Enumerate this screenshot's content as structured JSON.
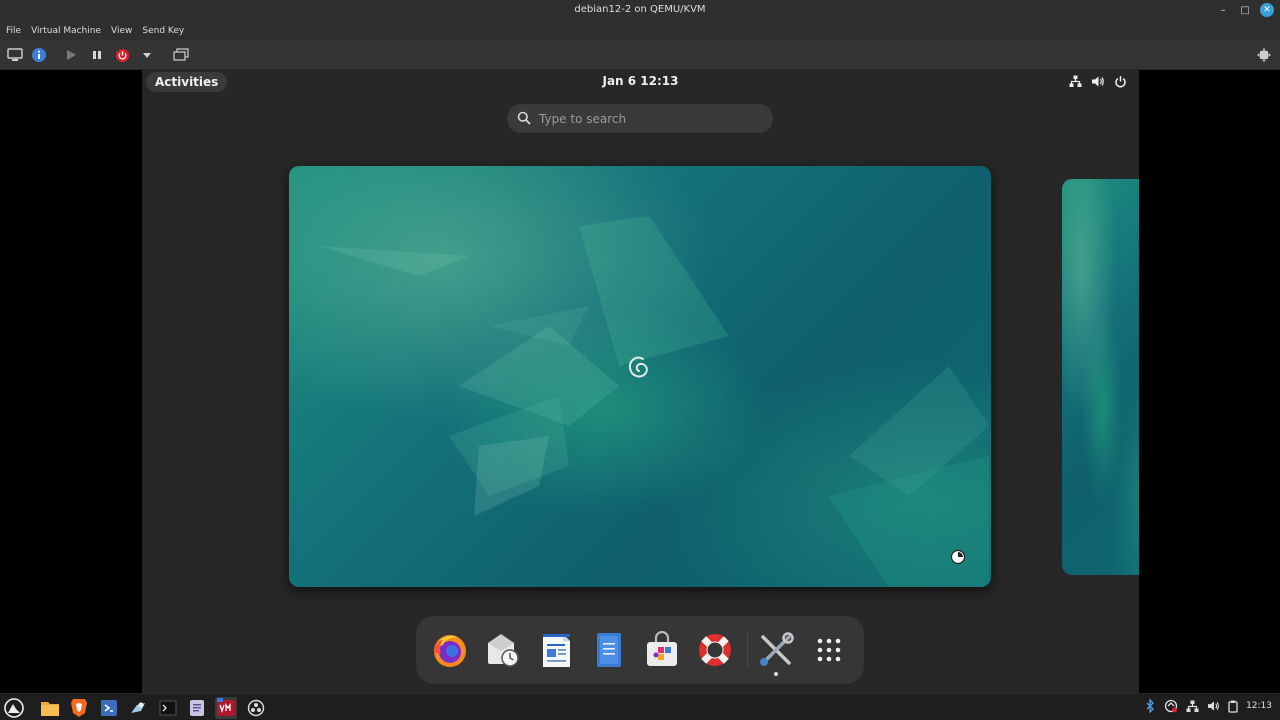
{
  "window": {
    "title": "debian12-2 on QEMU/KVM",
    "controls": {
      "minimize": "–",
      "maximize": "□",
      "close": "✕"
    }
  },
  "menubar": {
    "items": [
      "File",
      "Virtual Machine",
      "View",
      "Send Key"
    ]
  },
  "toolbar": {
    "buttons": [
      "console-icon",
      "info-icon",
      "play-icon",
      "pause-icon",
      "power-icon",
      "dropdown-icon",
      "snapshot-icon",
      "fullscreen-icon"
    ]
  },
  "guest": {
    "topbar": {
      "activities_label": "Activities",
      "clock": "Jan 6  12:13"
    },
    "search": {
      "placeholder": "Type to search"
    },
    "dock": {
      "apps": [
        "firefox",
        "evolution",
        "libreoffice-writer",
        "text-editor",
        "software",
        "help",
        "utilities"
      ],
      "show_apps_label": "Show Apps"
    }
  },
  "taskbar": {
    "tray_time": "12:13",
    "colors": {
      "accent": "#3aa0d8",
      "power_red": "#d8202e"
    }
  }
}
